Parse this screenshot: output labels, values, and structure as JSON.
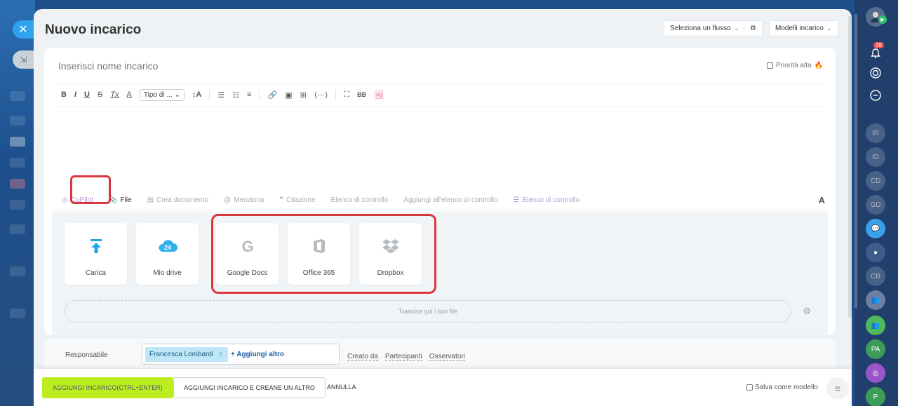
{
  "panel": {
    "title": "Nuovo incarico",
    "flow_select": "Seleziona un flusso",
    "templates_button": "Modelli incarico"
  },
  "form": {
    "name_placeholder": "Inserisci nome incarico",
    "priority_label": "Priorità alta"
  },
  "toolbar": {
    "bold": "B",
    "italic": "I",
    "underline": "U",
    "strike": "S",
    "clear": "Tx",
    "color": "A",
    "font_type": "Tipo di ...",
    "font_size": "↕A",
    "bb_label": "BB"
  },
  "tabs": {
    "copilot": "CoPilot",
    "file": "File",
    "create_doc": "Crea documento",
    "mention": "Menziona",
    "quote": "Citazione",
    "checklist": "Elenco di controllo",
    "add_checklist": "Aggiungi all'elenco di controllo",
    "checklist2": "Elenco di controllo",
    "format": "A"
  },
  "attach": {
    "tiles": [
      {
        "label": "Carica",
        "icon": "upload-icon"
      },
      {
        "label": "Mio drive",
        "icon": "drive24-icon",
        "badge": "24"
      },
      {
        "label": "Google Docs",
        "icon": "google-icon",
        "glyph": "G"
      },
      {
        "label": "Office 365",
        "icon": "office-icon"
      },
      {
        "label": "Dropbox",
        "icon": "dropbox-icon"
      }
    ],
    "drop_hint": "Trascina qui i tuoi file"
  },
  "responsible": {
    "label": "Responsabile",
    "person": "Francesca Lombardi",
    "add_more": "+ Aggiungi altro",
    "links": [
      "Creato da",
      "Partecipanti",
      "Osservatori"
    ]
  },
  "footer": {
    "add_task": "AGGIUNGI INCARICO(CTRL+ENTER)",
    "add_and_new": "AGGIUNGI INCARICO E CREANE UN ALTRO",
    "cancel": "ANNULLA",
    "save_template": "Salva come modello"
  },
  "rail": {
    "notifications_count": "38",
    "avatars": [
      "IR",
      "ID",
      "CD",
      "GD",
      "CB",
      "PA",
      "P"
    ]
  },
  "colors": {
    "accent_green": "#bbed21",
    "highlight_red": "#d9363e",
    "link_blue": "#1a5fa8",
    "chip_bg": "#bfe6f6"
  }
}
